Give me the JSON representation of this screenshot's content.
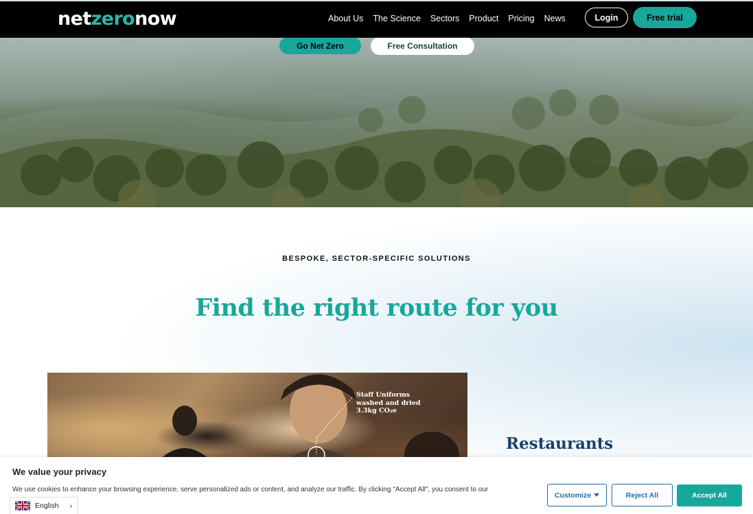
{
  "header": {
    "logo_part1": "net",
    "logo_part2": "zero",
    "logo_part3": "now",
    "nav": [
      "About Us",
      "The Science",
      "Sectors",
      "Product",
      "Pricing",
      "News"
    ],
    "login_label": "Login",
    "trial_label": "Free trial"
  },
  "hero": {
    "primary_cta": "Go Net Zero",
    "secondary_cta": "Free Consultation"
  },
  "section": {
    "eyebrow": "BESPOKE, SECTOR-SPECIFIC SOLUTIONS",
    "headline": "Find the right route for you",
    "card": {
      "annotation_line1": "Staff Uniforms",
      "annotation_line2": "washed and dried",
      "annotation_line3": "3.3kg CO₂e",
      "title": "Restaurants"
    }
  },
  "cookie": {
    "title": "We value your privacy",
    "text": "We use cookies to enhance your browsing experience, serve personalized ads or content, and analyze our traffic. By clicking \"Accept All\", you consent to our",
    "customize_label": "Customize",
    "reject_label": "Reject All",
    "accept_label": "Accept All"
  },
  "language": {
    "selected": "English"
  },
  "colors": {
    "brand_teal": "#17a79b",
    "navy": "#17416b",
    "cookie_blue": "#1b6ea5"
  }
}
